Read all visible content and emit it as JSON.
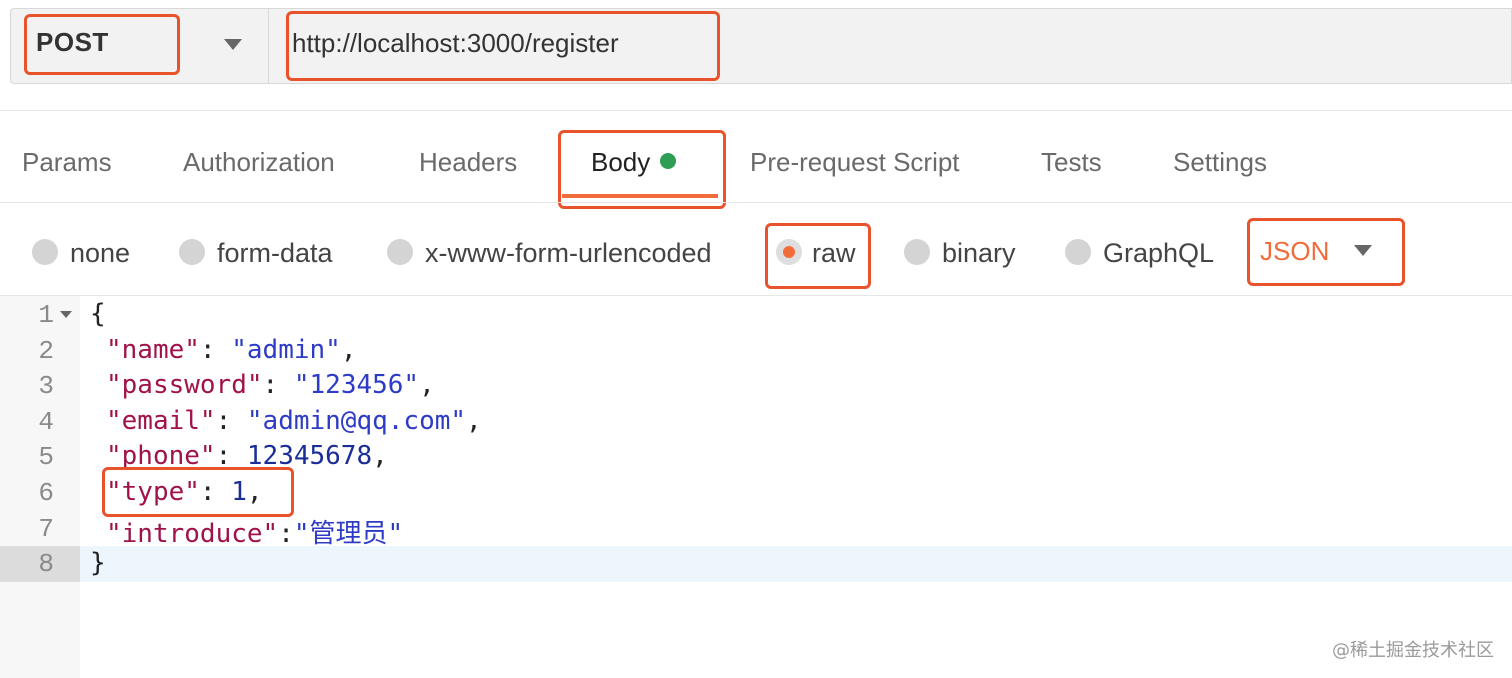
{
  "request": {
    "method": "POST",
    "url": "http://localhost:3000/register"
  },
  "tabs": [
    {
      "label": "Params"
    },
    {
      "label": "Authorization"
    },
    {
      "label": "Headers"
    },
    {
      "label": "Body",
      "active": true,
      "indicator_color": "#2f9e55"
    },
    {
      "label": "Pre-request Script"
    },
    {
      "label": "Tests"
    },
    {
      "label": "Settings"
    }
  ],
  "body_modes": [
    {
      "label": "none",
      "selected": false
    },
    {
      "label": "form-data",
      "selected": false
    },
    {
      "label": "x-www-form-urlencoded",
      "selected": false
    },
    {
      "label": "raw",
      "selected": true
    },
    {
      "label": "binary",
      "selected": false
    },
    {
      "label": "GraphQL",
      "selected": false
    }
  ],
  "content_type": "JSON",
  "editor": {
    "line_numbers": [
      "1",
      "2",
      "3",
      "4",
      "5",
      "6",
      "7",
      "8"
    ],
    "active_line": "8",
    "lines": [
      {
        "open": "{"
      },
      {
        "key": "\"name\"",
        "sep": ": ",
        "value": "\"admin\"",
        "end": ","
      },
      {
        "key": "\"password\"",
        "sep": ": ",
        "value": "\"123456\"",
        "end": ","
      },
      {
        "key": "\"email\"",
        "sep": ": ",
        "value": "\"admin@qq.com\"",
        "end": ","
      },
      {
        "key": "\"phone\"",
        "sep": ": ",
        "value": "12345678",
        "end": ","
      },
      {
        "key": "\"type\"",
        "sep": ": ",
        "value": "1",
        "end": ","
      },
      {
        "key": "\"introduce\"",
        "sep": ":",
        "value": "\"管理员\"",
        "end": ""
      },
      {
        "close": "}"
      }
    ]
  },
  "watermark": "@稀土掘金技术社区",
  "colors": {
    "accent": "#f26b3a",
    "highlight_box": "#e8532b",
    "json_key": "#a0134a",
    "json_string": "#2d3bc7",
    "json_number": "#1a2d99"
  }
}
